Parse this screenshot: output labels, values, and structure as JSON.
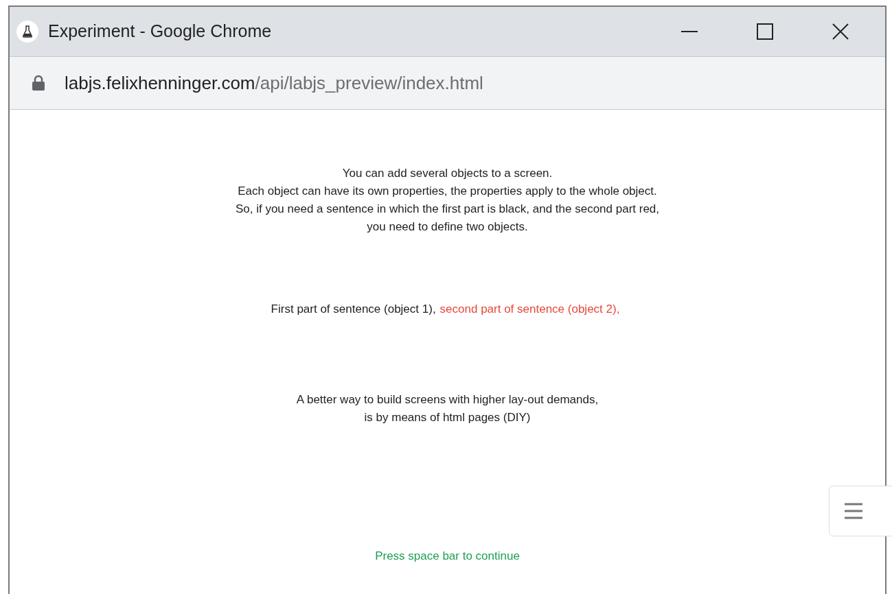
{
  "window": {
    "title": "Experiment - Google Chrome"
  },
  "address_bar": {
    "host": "labjs.felixhenninger.com",
    "path": "/api/labjs_preview/index.html"
  },
  "content": {
    "intro": [
      "You can add several objects to a screen.",
      "Each object can have its own properties, the properties apply to the whole object.",
      "So, if you need a sentence in which the first part is black, and the second part red,",
      "you need to define two objects."
    ],
    "sentence": [
      {
        "text": "First part of sentence (object 1),",
        "color": "#222222"
      },
      {
        "text": "second part of sentence (object 2),",
        "color": "#e8473a"
      }
    ],
    "note": [
      "A better way to build screens with higher lay-out demands,",
      "is by means of html pages (DIY)"
    ],
    "continue_hint": "Press space bar to continue"
  }
}
